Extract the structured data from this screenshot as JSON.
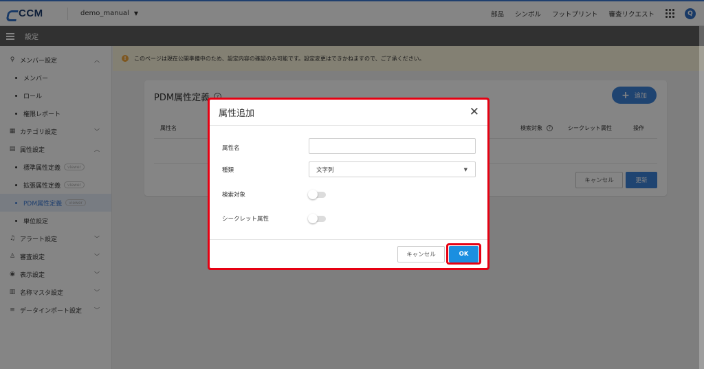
{
  "app": {
    "logo": "CCM",
    "workspace": "demo_manual"
  },
  "topnav": [
    "部品",
    "シンボル",
    "フットプリント",
    "審査リクエスト"
  ],
  "user_initial": "Q",
  "settings_title": "設定",
  "sidebar": {
    "groups": [
      {
        "icon": "person-icon",
        "label": "メンバー設定",
        "expanded": true,
        "items": [
          {
            "label": "メンバー"
          },
          {
            "label": "ロール"
          },
          {
            "label": "権限レポート"
          }
        ]
      },
      {
        "icon": "grid-icon",
        "label": "カテゴリ設定",
        "expanded": false,
        "items": []
      },
      {
        "icon": "list-icon",
        "label": "属性設定",
        "expanded": true,
        "items": [
          {
            "label": "標準属性定義",
            "badge": "viewer"
          },
          {
            "label": "拡張属性定義",
            "badge": "viewer"
          },
          {
            "label": "PDM属性定義",
            "badge": "viewer",
            "active": true
          },
          {
            "label": "単位設定"
          }
        ]
      },
      {
        "icon": "bell-icon",
        "label": "アラート設定",
        "expanded": false,
        "items": []
      },
      {
        "icon": "reviewer-icon",
        "label": "審査設定",
        "expanded": false,
        "items": []
      },
      {
        "icon": "eye-icon",
        "label": "表示設定",
        "expanded": false,
        "items": []
      },
      {
        "icon": "table-icon",
        "label": "名称マスタ設定",
        "expanded": false,
        "items": []
      },
      {
        "icon": "database-icon",
        "label": "データインポート設定",
        "expanded": false,
        "items": []
      }
    ]
  },
  "notice": "このページは現在公開準備中のため、設定内容の確認のみ可能です。設定変更はできかねますので、ご了承ください。",
  "card": {
    "title": "PDM属性定義",
    "add_label": "追加",
    "columns": {
      "name": "属性名",
      "search": "検索対象",
      "secret": "シークレット属性",
      "ops": "操作"
    },
    "cancel": "キャンセル",
    "update": "更新"
  },
  "modal": {
    "title": "属性追加",
    "fields": {
      "name_label": "属性名",
      "name_value": "",
      "type_label": "種類",
      "type_value": "文字列",
      "search_label": "検索対象",
      "secret_label": "シークレット属性"
    },
    "cancel": "キャンセル",
    "ok": "OK"
  },
  "colors": {
    "primary": "#3d82d8",
    "highlight": "#e60012",
    "ok": "#1a8fe0"
  }
}
